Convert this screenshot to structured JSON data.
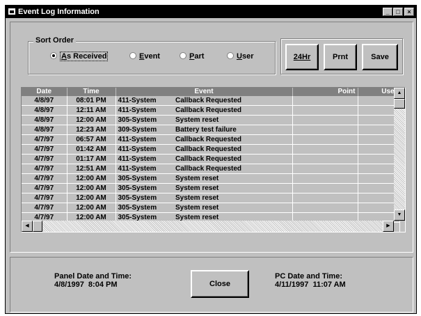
{
  "window": {
    "title": "Event Log Information",
    "controls": [
      "_",
      "□",
      "×"
    ]
  },
  "sort": {
    "group_label": "Sort Order",
    "options": [
      {
        "label": "As Received",
        "accel": "A",
        "selected": true
      },
      {
        "label": "Event",
        "accel": "E",
        "selected": false
      },
      {
        "label": "Part",
        "accel": "P",
        "selected": false
      },
      {
        "label": "User",
        "accel": "U",
        "selected": false
      }
    ]
  },
  "toolbar": {
    "hr24": "24Hr",
    "print": "Prnt",
    "save": "Save"
  },
  "table": {
    "headers": [
      "Date",
      "Time",
      "Event",
      "Point",
      "User"
    ],
    "rows": [
      [
        "4/8/97",
        "08:01 PM",
        "411-System",
        "Callback Requested",
        "",
        ""
      ],
      [
        "4/8/97",
        "12:11 AM",
        "411-System",
        "Callback Requested",
        "",
        ""
      ],
      [
        "4/8/97",
        "12:00 AM",
        "305-System",
        "System reset",
        "",
        ""
      ],
      [
        "4/8/97",
        "12:23 AM",
        "309-System",
        "Battery test failure",
        "",
        ""
      ],
      [
        "4/7/97",
        "06:57 AM",
        "411-System",
        "Callback Requested",
        "",
        ""
      ],
      [
        "4/7/97",
        "01:42 AM",
        "411-System",
        "Callback Requested",
        "",
        ""
      ],
      [
        "4/7/97",
        "01:17 AM",
        "411-System",
        "Callback Requested",
        "",
        ""
      ],
      [
        "4/7/97",
        "12:51 AM",
        "411-System",
        "Callback Requested",
        "",
        ""
      ],
      [
        "4/7/97",
        "12:00 AM",
        "305-System",
        "System reset",
        "",
        ""
      ],
      [
        "4/7/97",
        "12:00 AM",
        "305-System",
        "System reset",
        "",
        ""
      ],
      [
        "4/7/97",
        "12:00 AM",
        "305-System",
        "System reset",
        "",
        ""
      ],
      [
        "4/7/97",
        "12:00 AM",
        "305-System",
        "System reset",
        "",
        ""
      ],
      [
        "4/7/97",
        "12:00 AM",
        "305-System",
        "System reset",
        "",
        ""
      ]
    ]
  },
  "footer": {
    "panel_label": "Panel Date and Time:",
    "panel_value": "4/8/1997  8:04 PM",
    "close": "Close",
    "pc_label": "PC Date and Time:",
    "pc_value": "4/11/1997  11:07 AM"
  },
  "colors": {
    "titlebar": "#000000",
    "face": "#c0c0c0",
    "header": "#808080"
  }
}
